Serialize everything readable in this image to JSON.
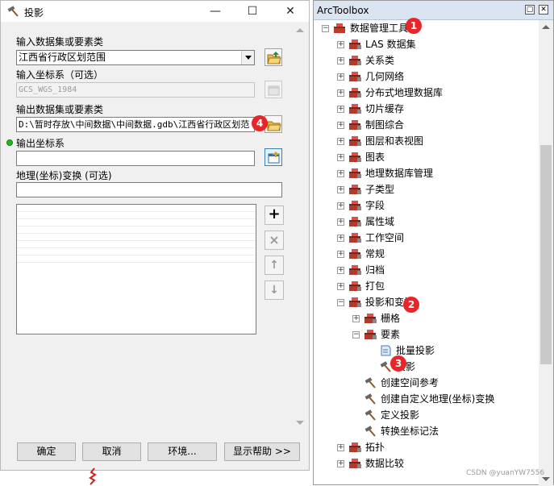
{
  "dialog": {
    "title": "投影",
    "fields": {
      "input_label": "输入数据集或要素类",
      "input_value": "江西省行政区划范围",
      "input_cs_label": "输入坐标系（可选）",
      "input_cs_value": "GCS_WGS_1984",
      "output_label": "输出数据集或要素类",
      "output_value": "D:\\暂时存放\\中间数据\\中间数据.gdb\\江西省行政区划范",
      "output_cs_label": "输出坐标系",
      "output_cs_value": "",
      "geo_transform_label": "地理(坐标)变换 (可选)",
      "geo_transform_value": ""
    },
    "side_buttons": {
      "add": "+",
      "remove": "×",
      "up": "↑",
      "down": "↓"
    },
    "buttons": {
      "ok": "确定",
      "cancel": "取消",
      "env": "环境...",
      "help": "显示帮助 >>"
    }
  },
  "toolbox": {
    "title": "ArcToolbox",
    "root": "数据管理工具",
    "items": [
      "LAS 数据集",
      "关系类",
      "几何网络",
      "分布式地理数据库",
      "切片缓存",
      "制图综合",
      "图层和表视图",
      "图表",
      "地理数据库管理",
      "子类型",
      "字段",
      "属性域",
      "工作空间",
      "常规",
      "归档",
      "打包"
    ],
    "projection_group": "投影和变换",
    "raster": "栅格",
    "feature": "要素",
    "feature_children": [
      "批量投影",
      "投影"
    ],
    "tools": [
      "创建空间参考",
      "创建自定义地理(坐标)变换",
      "定义投影",
      "转换坐标记法"
    ],
    "after": [
      "拓扑",
      "数据比较"
    ]
  },
  "badges": [
    "1",
    "2",
    "3",
    "4"
  ],
  "watermark": "CSDN @yuanYW7556",
  "colors": {
    "badge": "#e8262a",
    "title_bar": "#dbe4f1",
    "required_dot": "#22b422"
  }
}
